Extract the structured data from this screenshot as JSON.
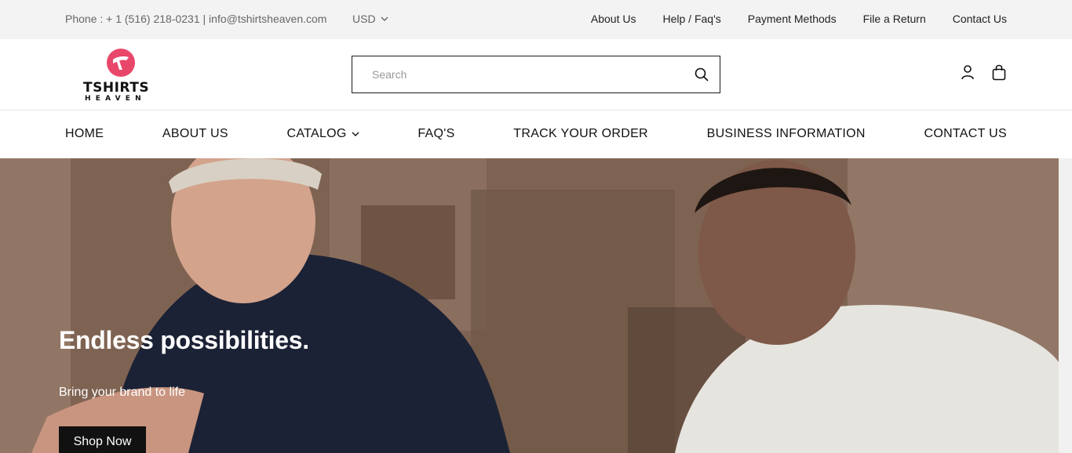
{
  "topbar": {
    "contact": "Phone : + 1 (516) 218-0231 | info@tshirtsheaven.com",
    "currency": "USD",
    "links": [
      "About Us",
      "Help / Faq's",
      "Payment Methods",
      "File a Return",
      "Contact Us"
    ]
  },
  "header": {
    "logo_word": "TSHIRTS",
    "logo_sub": "HEAVEN",
    "search_placeholder": "Search",
    "brand_color": "#e8476a"
  },
  "nav": {
    "items": [
      "HOME",
      "ABOUT US",
      "CATALOG",
      "FAQ'S",
      "TRACK YOUR ORDER",
      "BUSINESS INFORMATION",
      "CONTACT US"
    ]
  },
  "hero": {
    "title": "Endless possibilities.",
    "subtitle": "Bring your brand to life",
    "cta": "Shop Now"
  },
  "icons": {
    "search": "search-icon",
    "account": "user-icon",
    "cart": "shopping-bag-icon",
    "dropdown": "chevron-down-icon"
  }
}
